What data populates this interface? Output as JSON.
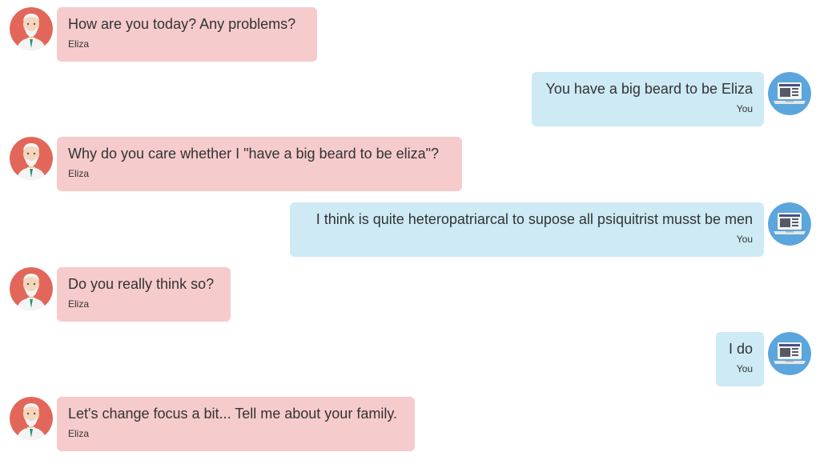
{
  "conversation": {
    "messages": [
      {
        "from": "eliza",
        "text": "How are you today? Any problems?",
        "sender": "Eliza"
      },
      {
        "from": "you",
        "text": "You have a big beard to be Eliza",
        "sender": "You"
      },
      {
        "from": "eliza",
        "text": "Why do you care whether I \"have a big beard to be eliza\"?",
        "sender": "Eliza"
      },
      {
        "from": "you",
        "text": "I think is quite heteropatriarcal to supose all psiquitrist musst be men",
        "sender": "You"
      },
      {
        "from": "eliza",
        "text": "Do you really think so?",
        "sender": "Eliza"
      },
      {
        "from": "you",
        "text": "I do",
        "sender": "You"
      },
      {
        "from": "eliza",
        "text": "Let's change focus a bit... Tell me about your family.",
        "sender": "Eliza"
      }
    ]
  },
  "icons": {
    "eliza_avatar": "doctor-avatar-icon",
    "user_avatar": "laptop-avatar-icon"
  },
  "colors": {
    "eliza_bubble": "#f6cbcb",
    "user_bubble": "#cdeaf5",
    "eliza_avatar_bg": "#e2675a",
    "user_avatar_bg": "#5ba6dc",
    "text": "#333333"
  }
}
